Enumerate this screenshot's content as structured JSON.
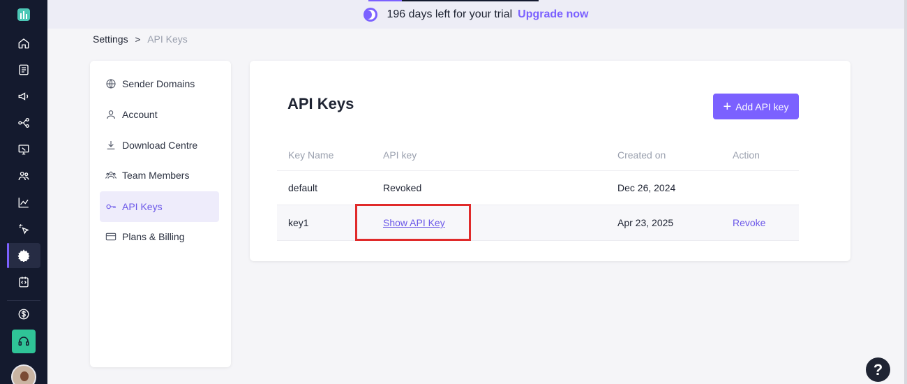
{
  "banner": {
    "trial_text": "196 days left for your trial",
    "upgrade_label": "Upgrade now"
  },
  "nav": {
    "items": [
      {
        "name": "home-icon"
      },
      {
        "name": "document-icon"
      },
      {
        "name": "megaphone-icon"
      },
      {
        "name": "workflow-icon"
      },
      {
        "name": "monitor-icon"
      },
      {
        "name": "contacts-icon"
      },
      {
        "name": "analytics-icon"
      },
      {
        "name": "click-icon"
      },
      {
        "name": "gear-icon",
        "active": true
      },
      {
        "name": "code-icon"
      },
      {
        "name": "dollar-icon"
      }
    ]
  },
  "breadcrumb": {
    "root": "Settings",
    "separator": ">",
    "current": "API Keys"
  },
  "settings_menu": {
    "items": [
      {
        "label": "Sender Domains",
        "icon": "globe-icon"
      },
      {
        "label": "Account",
        "icon": "user-icon"
      },
      {
        "label": "Download Centre",
        "icon": "download-icon"
      },
      {
        "label": "Team Members",
        "icon": "team-icon"
      },
      {
        "label": "API Keys",
        "icon": "key-icon",
        "active": true
      },
      {
        "label": "Plans & Billing",
        "icon": "card-icon"
      }
    ]
  },
  "main": {
    "title": "API Keys",
    "add_button_label": "Add API key",
    "table": {
      "headers": [
        "Key Name",
        "API key",
        "Created on",
        "Action"
      ],
      "rows": [
        {
          "name": "default",
          "api_key": "Revoked",
          "created": "Dec 26, 2024",
          "action": ""
        },
        {
          "name": "key1",
          "api_key": "Show API Key",
          "created": "Apr 23, 2025",
          "action": "Revoke"
        }
      ]
    }
  },
  "help": {
    "label": "?"
  },
  "colors": {
    "accent": "#7b61ff",
    "nav_bg": "#141a2e",
    "support_green": "#2fc497",
    "highlight_red": "#e02a2a"
  }
}
